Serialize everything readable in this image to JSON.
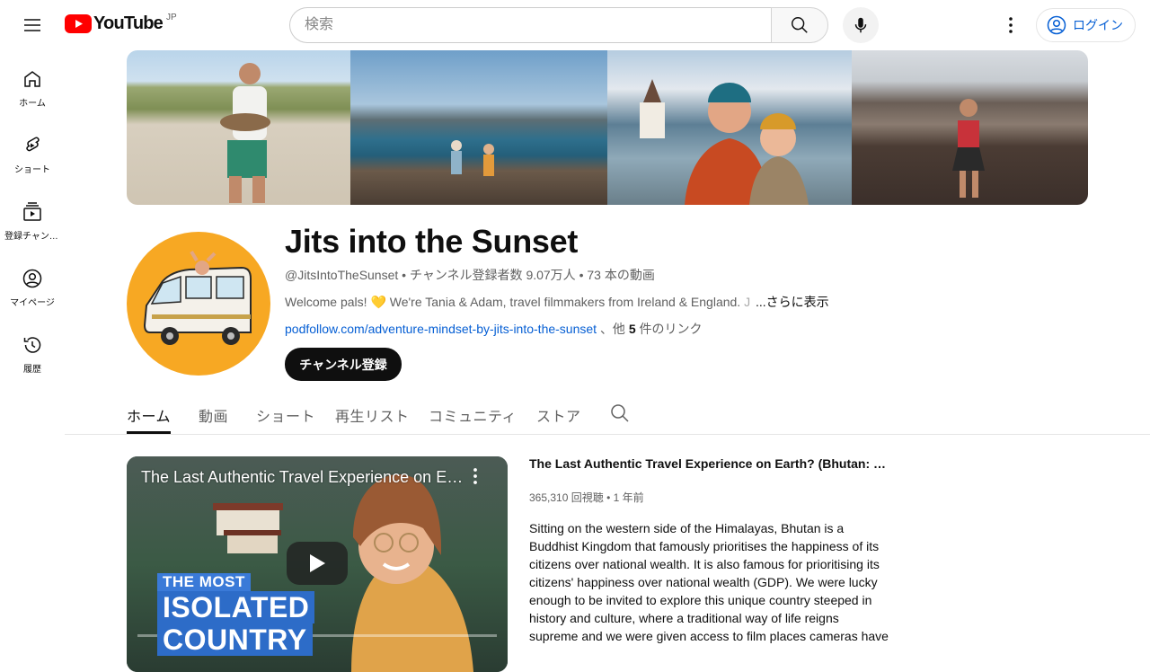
{
  "header": {
    "logo_text": "YouTube",
    "region": "JP",
    "search_placeholder": "検索",
    "signin_label": "ログイン"
  },
  "sidebar": {
    "items": [
      {
        "label": "ホーム",
        "icon": "home-icon"
      },
      {
        "label": "ショート",
        "icon": "shorts-icon"
      },
      {
        "label": "登録チャンネル",
        "icon": "subscriptions-icon"
      },
      {
        "label": "マイページ",
        "icon": "account-icon"
      },
      {
        "label": "履歴",
        "icon": "history-icon"
      }
    ]
  },
  "channel": {
    "name": "Jits into the Sunset",
    "handle": "@JitsIntoTheSunset",
    "subscribers": "チャンネル登録者数 9.07万人",
    "videos": "73 本の動画",
    "description": "Welcome pals! 💛 We're Tania & Adam, travel filmmakers from Ireland & England.",
    "description_fade": " J",
    "more_label": "...さらに表示",
    "link": "podfollow.com/adventure-mindset-by-jits-into-the-sunset",
    "links_prefix": "、他 ",
    "links_count": "5",
    "links_suffix": " 件のリンク",
    "subscribe_label": "チャンネル登録"
  },
  "tabs": [
    {
      "label": "ホーム",
      "active": true
    },
    {
      "label": "動画",
      "active": false
    },
    {
      "label": "ショート",
      "active": false
    },
    {
      "label": "再生リスト",
      "active": false
    },
    {
      "label": "コミュニティ",
      "active": false
    },
    {
      "label": "ストア",
      "active": false
    }
  ],
  "featured_video": {
    "title": "The Last Authentic Travel Experience on Earth? (Bhutan: Medieval Kingdom in the Himalayas)",
    "player_title": "The Last Authentic Travel Experience on Earth? (Bhutan: Medieval Kingdom in the Himalayas)",
    "views": "365,310 回視聴",
    "age": "1 年前",
    "thumb_line1": "THE MOST",
    "thumb_line2": "ISOLATED",
    "thumb_line3": "COUNTRY",
    "description": "Sitting on the western side of the Himalayas, Bhutan is a Buddhist Kingdom that famously prioritises the happiness of its citizens over national wealth. It is also famous for prioritising its citizens' happiness over national wealth (GDP). We were lucky enough to be invited to explore this unique country steeped in history and culture, where a traditional way of life reigns supreme and we were given access to film places cameras have never been before."
  },
  "colors": {
    "brand_red": "#ff0000",
    "link_blue": "#065fd4",
    "avatar_bg": "#f7a823"
  }
}
